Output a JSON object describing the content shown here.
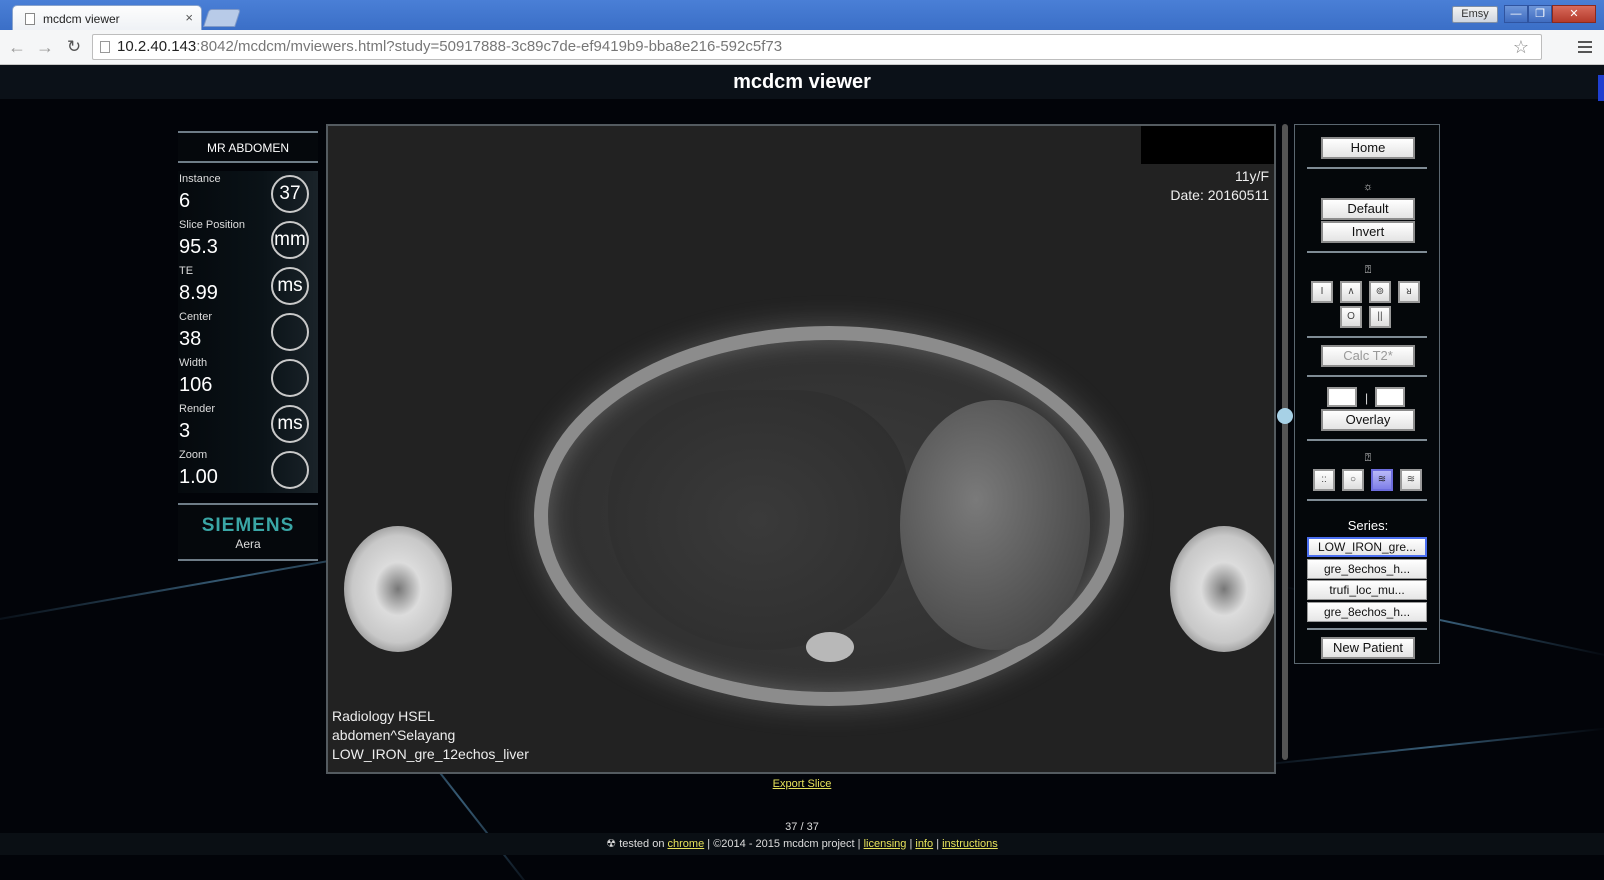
{
  "browser": {
    "tab_title": "mcdcm viewer",
    "tab_close": "×",
    "user_badge": "Emsy",
    "win_min": "—",
    "win_restore": "❐",
    "win_close": "✕",
    "url_host": "10.2.40.143",
    "url_rest": ":8042/mcdcm/mviewers.html?study=50917888-3c89c7de-ef9419b9-bba8e216-592c5f73",
    "back": "←",
    "forward": "→",
    "reload": "↻",
    "star": "☆"
  },
  "header": {
    "title": "mcdcm viewer"
  },
  "info": {
    "study_title": "MR ABDOMEN",
    "stats": [
      {
        "label": "Instance",
        "value": "6",
        "ring": "37"
      },
      {
        "label": "Slice Position",
        "value": "95.3",
        "ring": "mm"
      },
      {
        "label": "TE",
        "value": "8.99",
        "ring": "ms"
      },
      {
        "label": "Center",
        "value": "38",
        "ring": ""
      },
      {
        "label": "Width",
        "value": "106",
        "ring": ""
      },
      {
        "label": "Render",
        "value": "3",
        "ring": "ms"
      },
      {
        "label": "Zoom",
        "value": "1.00",
        "ring": ""
      }
    ],
    "vendor": "SIEMENS",
    "model": "Aera"
  },
  "viewport": {
    "top_right_1": "11y/F",
    "top_right_2": "Date: 20160511",
    "bottom_left_1": "Radiology HSEL",
    "bottom_left_2": "abdomen^Selayang",
    "bottom_left_3": "LOW_IRON_gre_12echos_liver"
  },
  "controls": {
    "home": "Home",
    "brightness_icon": "☼",
    "default": "Default",
    "invert": "Invert",
    "group2_icon": "⍰",
    "tools": [
      "I",
      "∧",
      "⊚",
      "ᴚ",
      "O",
      "||"
    ],
    "calc": "Calc T2*",
    "pipe": "|",
    "overlay": "Overlay",
    "group3_icon": "⍰",
    "modes": [
      "::",
      "○",
      "≋",
      "≋"
    ],
    "series_label": "Series:",
    "series": [
      "LOW_IRON_gre...",
      "gre_8echos_h...",
      "trufi_loc_mu...",
      "gre_8echos_h..."
    ],
    "new_patient": "New Patient"
  },
  "footer": {
    "export": "Export Slice",
    "page_count": "37 / 37",
    "icon": "☢",
    "tested_on": "tested on",
    "chrome": "chrome",
    "sep": "|",
    "copyright": "©2014 - 2015 mcdcm project",
    "licensing": "licensing",
    "info": "info",
    "instructions": "instructions"
  },
  "colors": {
    "accent_link": "#e8e35a",
    "vendor_teal": "#3aa6a6",
    "active_mode": "#7f7fe8"
  }
}
